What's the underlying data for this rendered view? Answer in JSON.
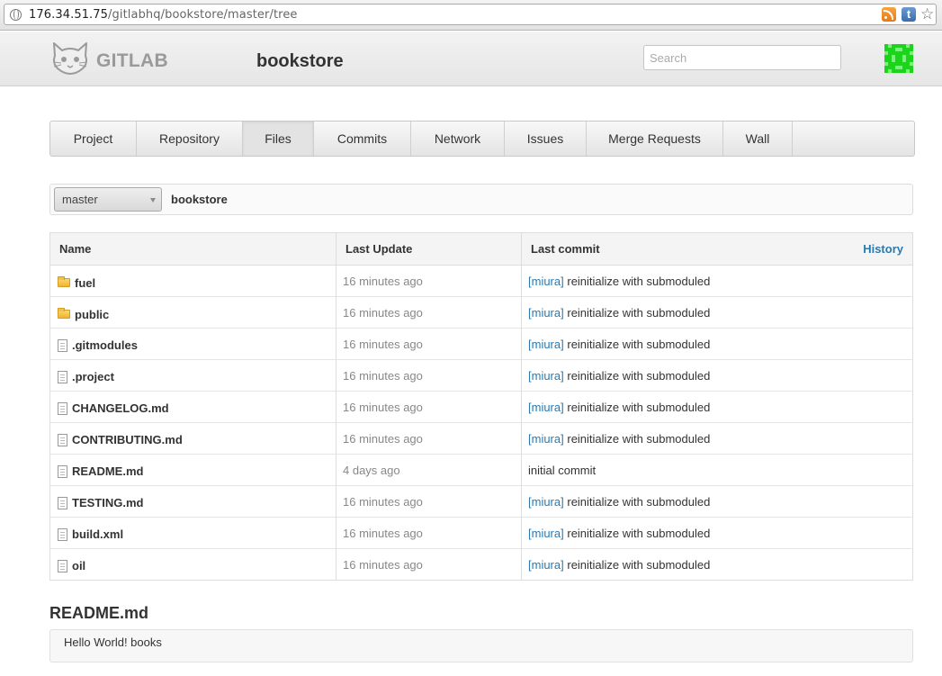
{
  "browser": {
    "url_host": "176.34.51.75",
    "url_path": "/gitlabhq/bookstore/master/tree",
    "icons": [
      "globe-icon",
      "rss-icon",
      "tumblr-icon",
      "star-icon"
    ]
  },
  "header": {
    "logo_text": "GITLAB",
    "project_title": "bookstore",
    "search_placeholder": "Search",
    "avatar_color": "#1bd41b"
  },
  "nav": {
    "tabs": [
      {
        "label": "Project"
      },
      {
        "label": "Repository"
      },
      {
        "label": "Files",
        "active": true
      },
      {
        "label": "Commits"
      },
      {
        "label": "Network"
      },
      {
        "label": "Issues"
      },
      {
        "label": "Merge Requests"
      },
      {
        "label": "Wall"
      }
    ]
  },
  "branch": {
    "selected": "master",
    "path": "bookstore"
  },
  "table": {
    "headers": {
      "name": "Name",
      "last_update": "Last Update",
      "last_commit": "Last commit",
      "history": "History"
    },
    "rows": [
      {
        "type": "folder",
        "name": "fuel",
        "updated": "16 minutes ago",
        "author": "[miura]",
        "message": "reinitialize with submoduled"
      },
      {
        "type": "folder",
        "name": "public",
        "updated": "16 minutes ago",
        "author": "[miura]",
        "message": "reinitialize with submoduled"
      },
      {
        "type": "file",
        "name": ".gitmodules",
        "updated": "16 minutes ago",
        "author": "[miura]",
        "message": "reinitialize with submoduled"
      },
      {
        "type": "file",
        "name": ".project",
        "updated": "16 minutes ago",
        "author": "[miura]",
        "message": "reinitialize with submoduled"
      },
      {
        "type": "file",
        "name": "CHANGELOG.md",
        "updated": "16 minutes ago",
        "author": "[miura]",
        "message": "reinitialize with submoduled"
      },
      {
        "type": "file",
        "name": "CONTRIBUTING.md",
        "updated": "16 minutes ago",
        "author": "[miura]",
        "message": "reinitialize with submoduled"
      },
      {
        "type": "file",
        "name": "README.md",
        "updated": "4 days ago",
        "author": "",
        "message": "initial commit"
      },
      {
        "type": "file",
        "name": "TESTING.md",
        "updated": "16 minutes ago",
        "author": "[miura]",
        "message": "reinitialize with submoduled"
      },
      {
        "type": "file",
        "name": "build.xml",
        "updated": "16 minutes ago",
        "author": "[miura]",
        "message": "reinitialize with submoduled"
      },
      {
        "type": "file",
        "name": "oil",
        "updated": "16 minutes ago",
        "author": "[miura]",
        "message": "reinitialize with submoduled"
      }
    ]
  },
  "readme": {
    "title": "README.md",
    "content": "Hello World! books"
  },
  "colors": {
    "link": "#2a7ab0",
    "muted_text": "#888888"
  }
}
